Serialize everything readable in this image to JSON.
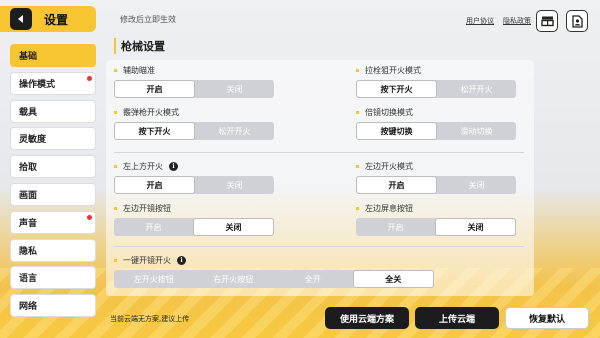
{
  "header": {
    "title": "设置",
    "hint": "修改后立即生效",
    "links": [
      "用户协议",
      "隐私政策"
    ]
  },
  "sidebar": {
    "items": [
      {
        "label": "基础",
        "active": true,
        "badge": false
      },
      {
        "label": "操作模式",
        "active": false,
        "badge": true
      },
      {
        "label": "载具",
        "active": false,
        "badge": false
      },
      {
        "label": "灵敏度",
        "active": false,
        "badge": false
      },
      {
        "label": "拾取",
        "active": false,
        "badge": false
      },
      {
        "label": "画面",
        "active": false,
        "badge": false
      },
      {
        "label": "声音",
        "active": false,
        "badge": true
      },
      {
        "label": "隐私",
        "active": false,
        "badge": false
      },
      {
        "label": "语言",
        "active": false,
        "badge": false
      },
      {
        "label": "网络",
        "active": false,
        "badge": false
      }
    ]
  },
  "section": {
    "title": "枪械设置"
  },
  "settings": [
    {
      "label": "辅助瞄准",
      "options": [
        "开启",
        "关闭"
      ],
      "selected": 0
    },
    {
      "label": "拉栓狙开火模式",
      "options": [
        "按下开火",
        "松开开火"
      ],
      "selected": 0
    },
    {
      "label": "霰弹枪开火模式",
      "options": [
        "按下开火",
        "松开开火"
      ],
      "selected": 0
    },
    {
      "label": "倍镜切换模式",
      "options": [
        "按键切换",
        "滑动切换"
      ],
      "selected": 0
    },
    {
      "label": "左上方开火",
      "options": [
        "开启",
        "关闭"
      ],
      "selected": 0
    },
    {
      "label": "左边开火模式",
      "options": [
        "开启",
        "关闭"
      ],
      "selected": 0
    },
    {
      "label": "左边开镜按钮",
      "options": [
        "开启",
        "关闭"
      ],
      "selected": 1
    },
    {
      "label": "左边屏息按钮",
      "options": [
        "开启",
        "关闭"
      ],
      "selected": 1
    },
    {
      "label": "一键开镜开火",
      "options": [
        "左开火按钮",
        "右开火按钮",
        "全开",
        "全关"
      ],
      "selected": 3
    }
  ],
  "footer": {
    "cloud_hint": "当前云端无方案,建议上传",
    "use_cloud": "使用云端方案",
    "upload_cloud": "上传云端",
    "restore_default": "恢复默认"
  },
  "icons": {
    "back": "back-arrow-icon",
    "gift": "ticket-icon",
    "profile": "user-settings-icon",
    "info": "info-icon"
  },
  "colors": {
    "accent": "#f6c531",
    "dark": "#1b1b20",
    "badge": "#ee3333"
  }
}
